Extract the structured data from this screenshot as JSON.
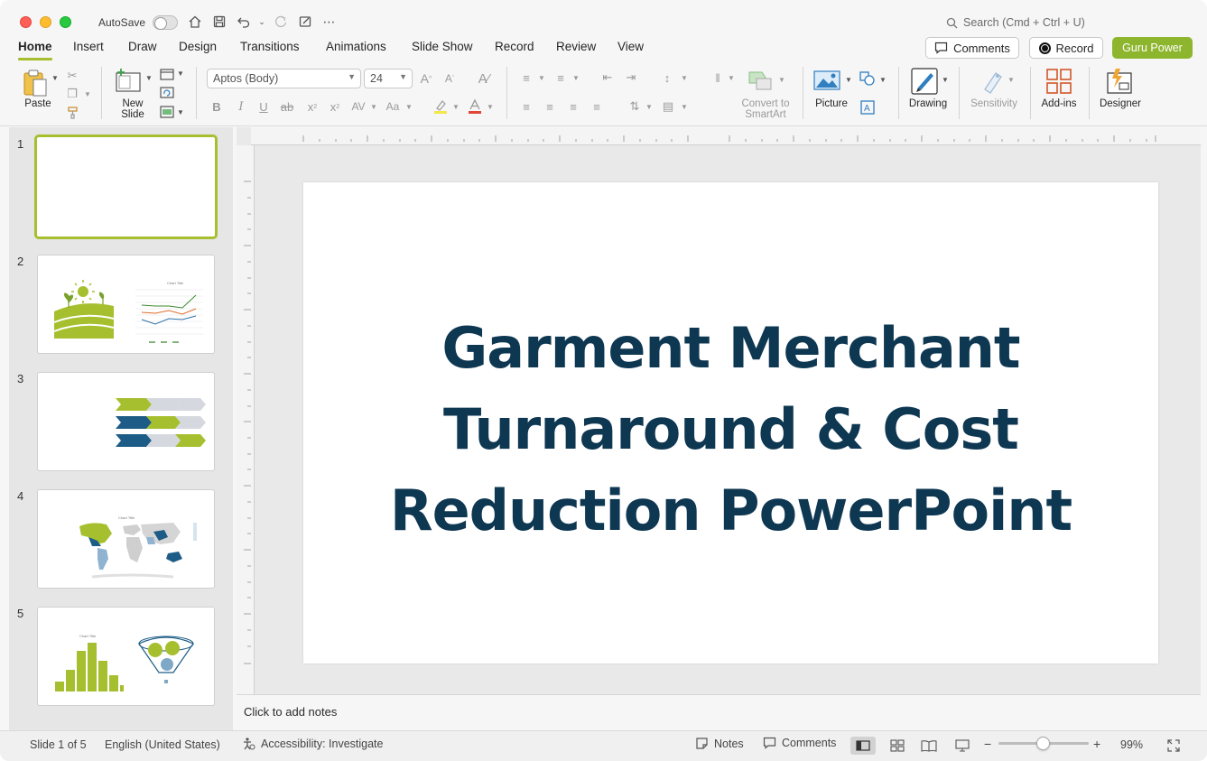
{
  "titlebar": {
    "autosave_label": "AutoSave",
    "search_placeholder": "Search (Cmd + Ctrl + U)"
  },
  "tabs": [
    {
      "label": "Home",
      "active": true
    },
    {
      "label": "Insert"
    },
    {
      "label": "Draw"
    },
    {
      "label": "Design"
    },
    {
      "label": "Transitions"
    },
    {
      "label": "Animations"
    },
    {
      "label": "Slide Show"
    },
    {
      "label": "Record"
    },
    {
      "label": "Review"
    },
    {
      "label": "View"
    }
  ],
  "actions": {
    "comments": "Comments",
    "record": "Record",
    "guru": "Guru Power"
  },
  "ribbon": {
    "paste": "Paste",
    "new_slide_1": "New",
    "new_slide_2": "Slide",
    "font_name": "Aptos (Body)",
    "font_size": "24",
    "convert_1": "Convert to",
    "convert_2": "SmartArt",
    "picture": "Picture",
    "drawing": "Drawing",
    "sensitivity": "Sensitivity",
    "addins": "Add-ins",
    "designer": "Designer"
  },
  "thumbnails": [
    {
      "number": "1"
    },
    {
      "number": "2",
      "chart_title": "Chart Title"
    },
    {
      "number": "3"
    },
    {
      "number": "4",
      "chart_title": "Chart Title"
    },
    {
      "number": "5",
      "chart_title": "Chart Title"
    }
  ],
  "slide": {
    "title_lines": [
      "Garment Merchant",
      "Turnaround & Cost",
      "Reduction PowerPoint"
    ]
  },
  "notes": {
    "placeholder": "Click to add notes"
  },
  "status": {
    "slide_counter": "Slide 1 of 5",
    "language": "English (United States)",
    "accessibility": "Accessibility: Investigate",
    "notes": "Notes",
    "comments": "Comments",
    "zoom": "99%"
  },
  "colors": {
    "accent": "#a6bf2e",
    "guru_button": "#8db52e",
    "title_navy": "#0e3752",
    "chevron_blue": "#1d5c86"
  }
}
